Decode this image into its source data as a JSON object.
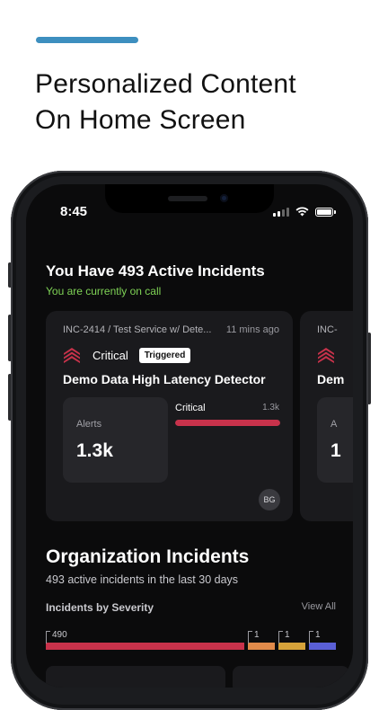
{
  "promo": {
    "headline_line1": "Personalized Content",
    "headline_line2": "On Home Screen",
    "accent_color": "#3d8fbf"
  },
  "status_bar": {
    "time": "8:45",
    "icons": [
      "signal-icon",
      "wifi-icon",
      "battery-icon"
    ]
  },
  "home": {
    "greeting": "You Have 493 Active Incidents",
    "on_call": "You are currently on call"
  },
  "incident_card": {
    "id_service": "INC-2414 / Test Service w/ Dete...",
    "time_ago": "11 mins ago",
    "severity": "Critical",
    "status_badge": "Triggered",
    "title": "Demo Data High Latency Detector",
    "alerts_label": "Alerts",
    "alerts_value": "1.3k",
    "critical_label": "Critical",
    "critical_value": "1.3k",
    "critical_fraction": 1.0,
    "assignee_initials": "BG",
    "severity_color": "#c8324b"
  },
  "incident_card_2": {
    "id_prefix": "INC-",
    "title_prefix": "Dem",
    "alerts_prefix": "A",
    "value_prefix": "1"
  },
  "organization": {
    "title": "Organization Incidents",
    "subtitle": "493 active incidents in the last 30 days",
    "severity_heading": "Incidents by Severity",
    "view_all": "View All",
    "severity_bars": [
      {
        "count": "490",
        "value": 490,
        "color": "#c8324b"
      },
      {
        "count": "1",
        "value": 1,
        "color": "#e08a4a"
      },
      {
        "count": "1",
        "value": 1,
        "color": "#d6a23a"
      },
      {
        "count": "1",
        "value": 1,
        "color": "#5a5fd6"
      }
    ]
  }
}
